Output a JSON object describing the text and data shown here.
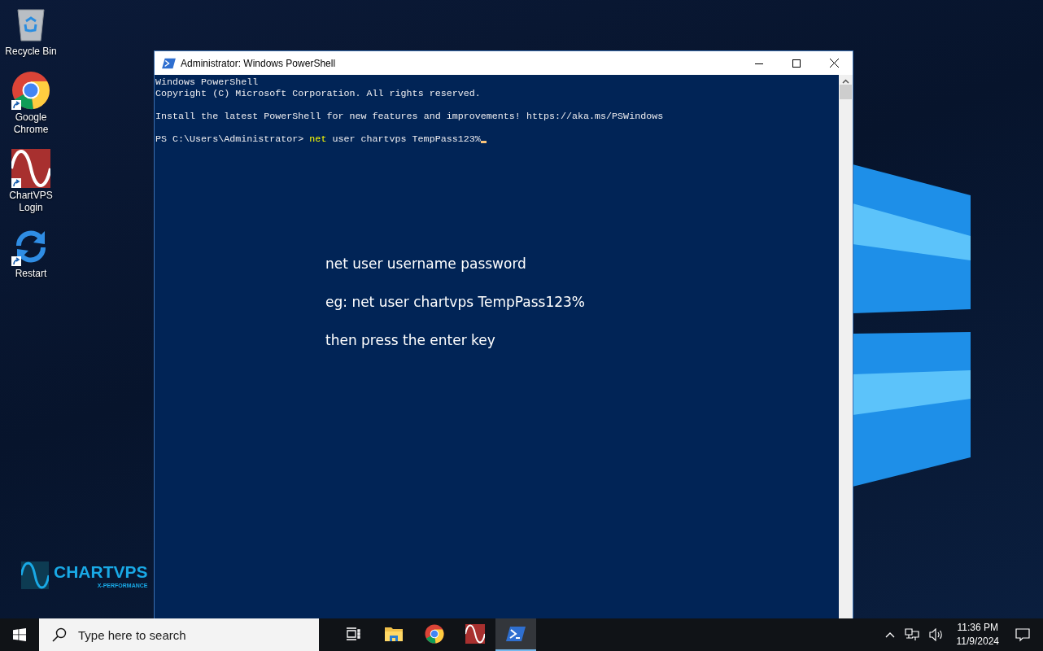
{
  "desktop_icons": [
    {
      "label": "Recycle Bin",
      "kind": "recycle",
      "shortcut": false
    },
    {
      "label": "Google Chrome",
      "kind": "chrome",
      "shortcut": true
    },
    {
      "label": "ChartVPS Login",
      "kind": "wave",
      "shortcut": true
    },
    {
      "label": "Restart",
      "kind": "restart",
      "shortcut": true
    }
  ],
  "brand": {
    "name": "CHARTVPS",
    "tagline": "X-PERFORMANCE"
  },
  "window": {
    "title": "Administrator: Windows PowerShell",
    "paragraphs": [
      [
        "Windows PowerShell",
        "Copyright (C) Microsoft Corporation. All rights reserved."
      ],
      [
        "Install the latest PowerShell for new features and improvements! https://aka.ms/PSWindows"
      ]
    ],
    "prompt": {
      "path": "PS C:\\Users\\Administrator>",
      "command": "net",
      "args": "user chartvps TempPass123%"
    },
    "instructions": [
      "net user username password",
      "eg: net user chartvps TempPass123%",
      "then press the enter key"
    ]
  },
  "taskbar": {
    "search": {
      "placeholder": "Type here to search"
    },
    "apps": [
      {
        "kind": "taskview",
        "selected": false
      },
      {
        "kind": "explorer",
        "selected": false
      },
      {
        "kind": "chrome",
        "selected": false
      },
      {
        "kind": "wave",
        "selected": false
      },
      {
        "kind": "powershell",
        "selected": true
      }
    ],
    "time": "11:36 PM",
    "date": "11/9/2024"
  }
}
